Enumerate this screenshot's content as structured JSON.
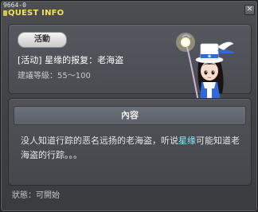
{
  "quest_id": "9664-0",
  "window_title": "QUEST INFO",
  "close_symbol": "✕",
  "badge": "活動",
  "quest_name": "[活动] 星缘的报复：老海盗",
  "quest_level": "建議等級：55～100",
  "content_header": "內容",
  "content_text_before": "没人知道行踪的恶名远扬的老海盗，听说",
  "content_highlight": "星缘",
  "content_text_after": "可能知道老海盗的行踪。。。",
  "status": "狀態：可開始",
  "colors": {
    "title": "#f4e05a",
    "highlight": "#8ae8ff",
    "panel": "#4a4c52"
  },
  "icons": [
    "close-icon",
    "npc-portrait"
  ]
}
